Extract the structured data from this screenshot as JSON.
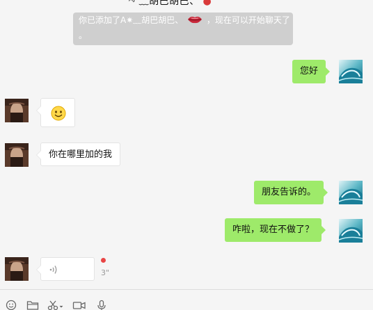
{
  "header": {
    "title_fragment": "ᴬᴶ ﹏胡巴胡巴、"
  },
  "system_notice": {
    "line1_before": "你已添加了A✷﹏胡巴胡巴、",
    "line1_after": "，现在可以开始聊天了",
    "line2": "。"
  },
  "messages": [
    {
      "side": "right",
      "type": "text",
      "text": "您好"
    },
    {
      "side": "left",
      "type": "emoji",
      "emoji": "smiley-face"
    },
    {
      "side": "left",
      "type": "text",
      "text": "你在哪里加的我"
    },
    {
      "side": "right",
      "type": "text",
      "text": "朋友告诉的。"
    },
    {
      "side": "right",
      "type": "text",
      "text": "咋啦，现在不做了？"
    },
    {
      "side": "left",
      "type": "voice",
      "duration": "3\"",
      "unread": true
    }
  ],
  "toolbar": {
    "items": [
      "emoji-icon",
      "folder-icon",
      "scissors-icon",
      "video-call-icon",
      "microphone-icon"
    ]
  },
  "colors": {
    "sent_bubble": "#9eea6a",
    "received_bubble": "#ffffff",
    "unread_dot": "#e84545",
    "notice_bg": "#cfcfcf"
  }
}
